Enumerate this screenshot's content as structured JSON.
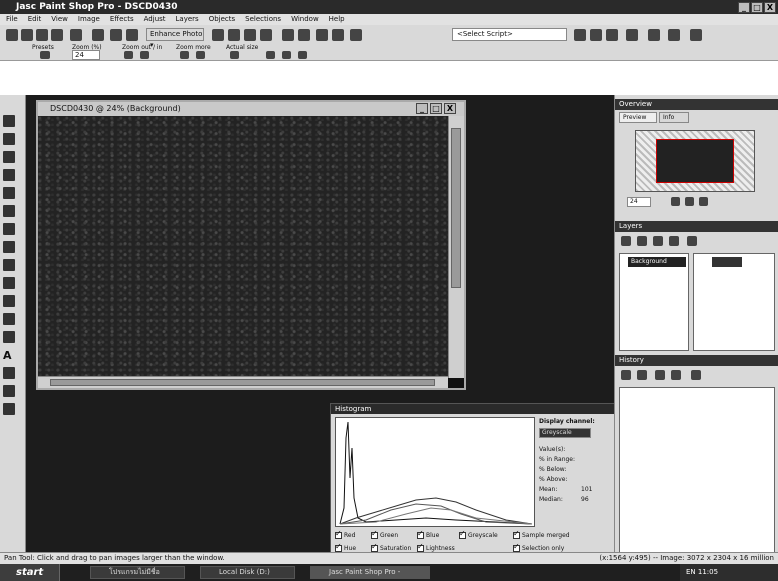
{
  "window": {
    "title": "Jasc Paint Shop Pro - DSCD0430",
    "buttons": [
      "_",
      "□",
      "X"
    ]
  },
  "menu": [
    "File",
    "Edit",
    "View",
    "Image",
    "Effects",
    "Adjust",
    "Layers",
    "Objects",
    "Selections",
    "Window",
    "Help"
  ],
  "toolbar": {
    "enhance_label": "Enhance Photo ▾",
    "script_select": "<Select Script>",
    "tool_options_labels": [
      "Presets",
      "Zoom (%)",
      "Zoom out / in",
      "Zoom more",
      "Actual size"
    ],
    "zoom_value": "24"
  },
  "image_window": {
    "title": "DSCD0430 @ 24% (Background)"
  },
  "histogram": {
    "title": "Histogram",
    "display_channel_label": "Display channel:",
    "channel_select": "Greyscale",
    "stats": [
      "Value(s):",
      "% in Range:",
      "% Below:",
      "% Above:"
    ],
    "mean_label": "Mean:",
    "mean_value": "101",
    "median_label": "Median:",
    "median_value": "96",
    "checks_row1": [
      "Red",
      "Green",
      "Blue",
      "Greyscale",
      "Sample merged"
    ],
    "checks_row2": [
      "Hue",
      "Saturation",
      "Lightness",
      "Selection only"
    ]
  },
  "overview": {
    "title": "Overview",
    "tabs": [
      "Preview",
      "Info"
    ],
    "zoom": "24"
  },
  "layers": {
    "title": "Layers",
    "layer_name": "Background"
  },
  "history": {
    "title": "History"
  },
  "status": {
    "hint": "Pan Tool: Click and drag to pan images larger than the window.",
    "info": "(x:1564 y:495) -- Image: 3072 x 2304 x 16 million"
  },
  "taskbar": {
    "start": "start",
    "tasks": [
      "โปรแกรมไม่มีชื่อ",
      "Local Disk (D:)",
      "Jasc Paint Shop Pro -"
    ],
    "tray": "EN  11:05"
  }
}
